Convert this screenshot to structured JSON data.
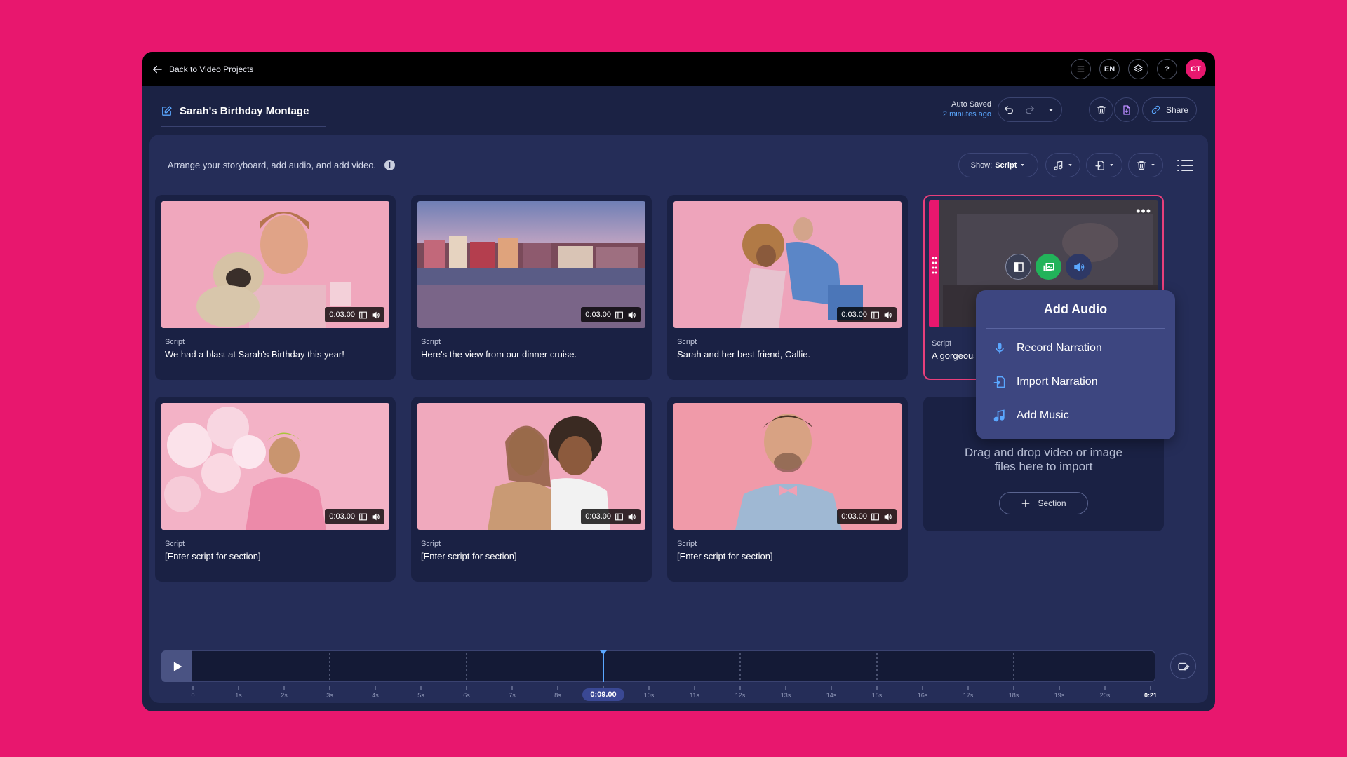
{
  "topbar": {
    "back_label": "Back to Video Projects",
    "language": "EN",
    "help": "?",
    "user_initials": "CT"
  },
  "project": {
    "title": "Sarah's Birthday Montage",
    "autosave_status": "Auto Saved",
    "autosave_time": "2 minutes ago",
    "share_label": "Share"
  },
  "toolbar": {
    "hint": "Arrange your storyboard, add audio, and add video.",
    "show_label": "Show:",
    "show_value": "Script"
  },
  "cards": [
    {
      "duration": "0:03.00",
      "script_label": "Script",
      "script": "We had a blast at Sarah's Birthday this year!"
    },
    {
      "duration": "0:03.00",
      "script_label": "Script",
      "script": "Here's the view from our dinner cruise."
    },
    {
      "duration": "0:03.00",
      "script_label": "Script",
      "script": "Sarah and her best friend, Callie."
    },
    {
      "duration": "",
      "script_label": "Script",
      "script": "A gorgeous"
    },
    {
      "duration": "0:03.00",
      "script_label": "Script",
      "script": "[Enter script for section]"
    },
    {
      "duration": "0:03.00",
      "script_label": "Script",
      "script": "[Enter script for section]"
    },
    {
      "duration": "0:03.00",
      "script_label": "Script",
      "script": "[Enter script for section]"
    }
  ],
  "dropzone": {
    "text_line1": "Drag and drop video or image",
    "text_line2": "files here to import",
    "button_label": "Section"
  },
  "add_audio_menu": {
    "title": "Add Audio",
    "items": [
      "Record Narration",
      "Import Narration",
      "Add Music"
    ]
  },
  "timeline": {
    "ticks": [
      "0",
      "1s",
      "2s",
      "3s",
      "4s",
      "5s",
      "6s",
      "7s",
      "8s",
      "9s",
      "10s",
      "11s",
      "12s",
      "13s",
      "14s",
      "15s",
      "16s",
      "17s",
      "18s",
      "19s",
      "20s",
      "0:21"
    ],
    "current_time": "0:09.00",
    "playhead_seconds": 9,
    "total_seconds": 21
  },
  "colors": {
    "background": "#e8176e",
    "app": "#1b2244",
    "panel": "#252d58",
    "accent": "#e8176e",
    "link": "#5aa7ff",
    "green": "#22b35a"
  },
  "icons": [
    "back-arrow-icon",
    "menu-icon",
    "layers-icon",
    "edit-icon",
    "undo-icon",
    "redo-icon",
    "trash-icon",
    "export-icon",
    "link-icon",
    "info-icon",
    "music-icon",
    "import-icon",
    "list-icon",
    "screen-icon",
    "speaker-icon",
    "mic-icon",
    "play-icon",
    "plus-icon"
  ]
}
